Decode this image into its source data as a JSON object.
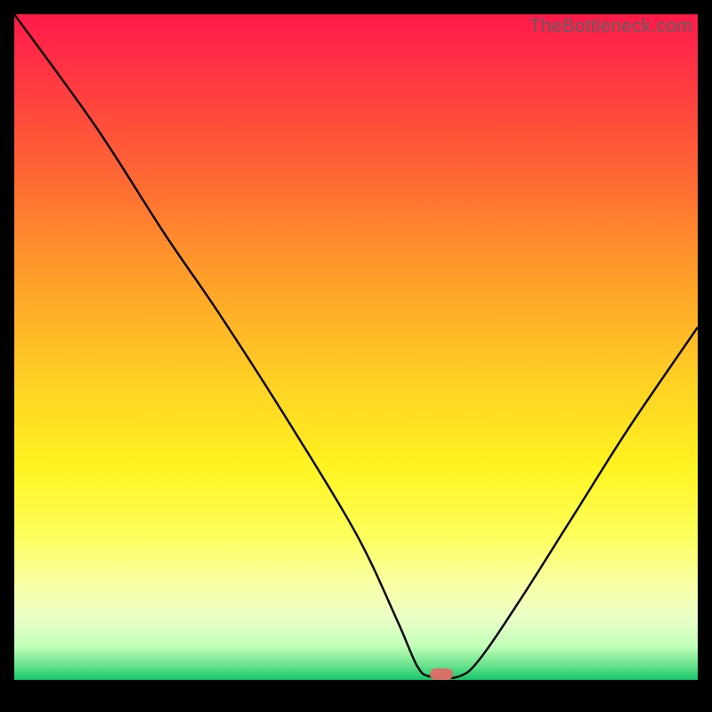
{
  "watermark": "TheBottleneck.com",
  "marker": {
    "x_pct": 62.5,
    "y_pct": 99.2
  },
  "chart_data": {
    "type": "line",
    "title": "",
    "xlabel": "",
    "ylabel": "",
    "xlim": [
      0,
      100
    ],
    "ylim": [
      0,
      100
    ],
    "grid": false,
    "legend": false,
    "annotations": [
      "TheBottleneck.com"
    ],
    "gradient_colors": {
      "top": "#ff1a4b",
      "mid_upper": "#ffa029",
      "mid": "#fff320",
      "mid_lower": "#f8ffa8",
      "bottom": "#13c46a"
    },
    "series": [
      {
        "name": "bottleneck-curve",
        "color": "#000000",
        "points": [
          {
            "x": 0,
            "y": 100
          },
          {
            "x": 12,
            "y": 83
          },
          {
            "x": 22,
            "y": 67
          },
          {
            "x": 30,
            "y": 55
          },
          {
            "x": 40,
            "y": 39
          },
          {
            "x": 50,
            "y": 22
          },
          {
            "x": 56,
            "y": 9
          },
          {
            "x": 59,
            "y": 2
          },
          {
            "x": 61,
            "y": 0.5
          },
          {
            "x": 65,
            "y": 0.5
          },
          {
            "x": 68,
            "y": 3
          },
          {
            "x": 74,
            "y": 12
          },
          {
            "x": 82,
            "y": 25
          },
          {
            "x": 90,
            "y": 38
          },
          {
            "x": 100,
            "y": 53
          }
        ]
      }
    ],
    "optimal_marker": {
      "x": 62.5,
      "y": 0.8,
      "color": "#d97168"
    }
  }
}
